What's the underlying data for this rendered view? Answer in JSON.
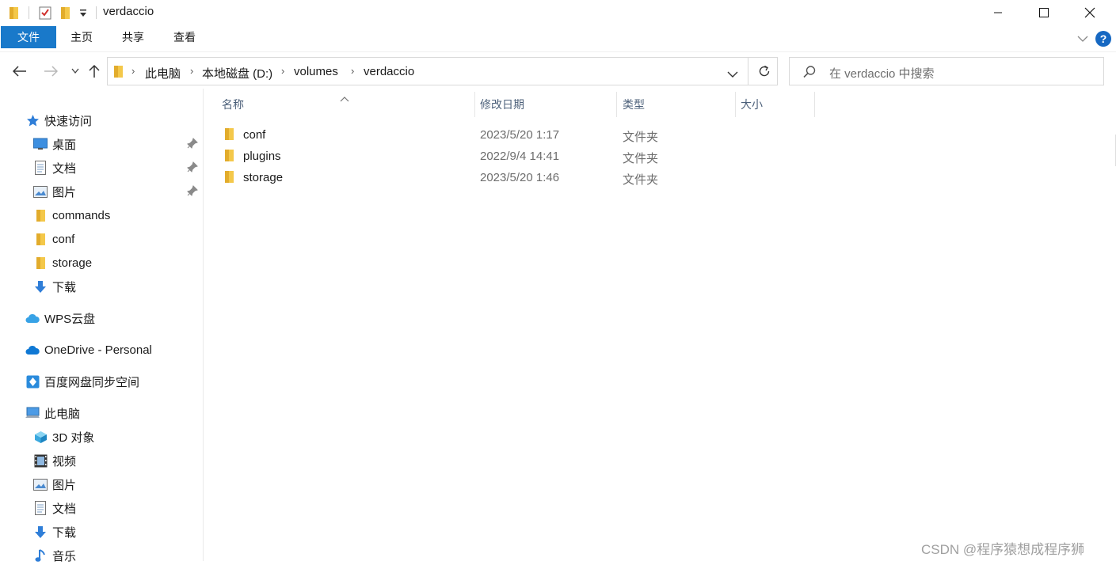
{
  "window": {
    "title": "verdaccio"
  },
  "ribbon": {
    "tabs": [
      "文件",
      "主页",
      "共享",
      "查看"
    ],
    "help_label": "?"
  },
  "address": {
    "crumbs": [
      "此电脑",
      "本地磁盘 (D:)",
      "volumes",
      "verdaccio"
    ]
  },
  "search": {
    "placeholder": "在 verdaccio 中搜索"
  },
  "sidebar": {
    "quick_access": "快速访问",
    "quick_items": [
      {
        "label": "桌面",
        "icon": "desktop-icon",
        "pinned": true
      },
      {
        "label": "文档",
        "icon": "document-icon",
        "pinned": true
      },
      {
        "label": "图片",
        "icon": "picture-icon",
        "pinned": true
      },
      {
        "label": "commands",
        "icon": "folder-icon",
        "pinned": false
      },
      {
        "label": "conf",
        "icon": "folder-icon",
        "pinned": false
      },
      {
        "label": "storage",
        "icon": "folder-icon",
        "pinned": false
      },
      {
        "label": "下载",
        "icon": "download-icon",
        "pinned": false
      }
    ],
    "wps": "WPS云盘",
    "onedrive": "OneDrive - Personal",
    "baidu": "百度网盘同步空间",
    "this_pc": "此电脑",
    "pc_items": [
      {
        "label": "3D 对象",
        "icon": "3d-objects-icon"
      },
      {
        "label": "视频",
        "icon": "video-icon"
      },
      {
        "label": "图片",
        "icon": "picture-icon"
      },
      {
        "label": "文档",
        "icon": "document-icon"
      },
      {
        "label": "下载",
        "icon": "download-icon"
      },
      {
        "label": "音乐",
        "icon": "music-icon"
      }
    ]
  },
  "columns": {
    "name": "名称",
    "date": "修改日期",
    "type": "类型",
    "size": "大小"
  },
  "files": [
    {
      "name": "conf",
      "date": "2023/5/20 1:17",
      "type": "文件夹"
    },
    {
      "name": "plugins",
      "date": "2022/9/4 14:41",
      "type": "文件夹"
    },
    {
      "name": "storage",
      "date": "2023/5/20 1:46",
      "type": "文件夹"
    }
  ],
  "watermark": "CSDN @程序猿想成程序狮",
  "colors": {
    "accent": "#1979ca",
    "folder": "#f4c84a",
    "header_text": "#4c607a"
  }
}
